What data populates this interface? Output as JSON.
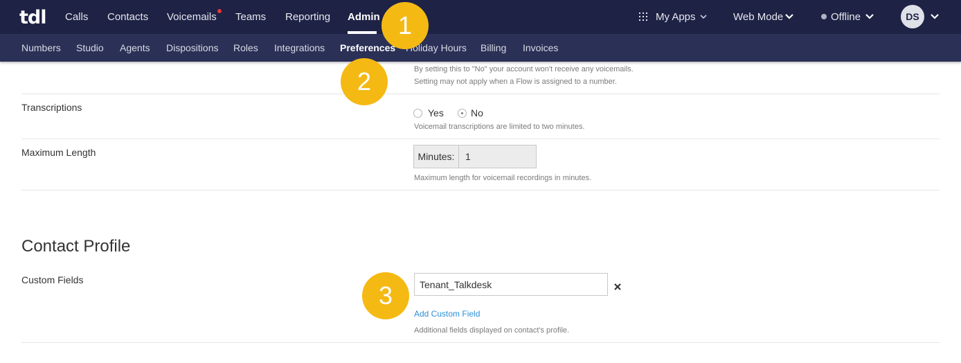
{
  "header": {
    "logo": "tdl",
    "nav": [
      {
        "label": "Calls"
      },
      {
        "label": "Contacts"
      },
      {
        "label": "Voicemails"
      },
      {
        "label": "Teams"
      },
      {
        "label": "Reporting"
      },
      {
        "label": "Admin"
      }
    ],
    "active_nav": "Admin",
    "my_apps": "My Apps",
    "web_mode": "Web Mode",
    "status": "Offline",
    "avatar_initials": "DS"
  },
  "subnav": {
    "items": [
      {
        "label": "Numbers"
      },
      {
        "label": "Studio"
      },
      {
        "label": "Agents"
      },
      {
        "label": "Dispositions"
      },
      {
        "label": "Roles"
      },
      {
        "label": "Integrations"
      },
      {
        "label": "Preferences"
      },
      {
        "label": "Holiday Hours"
      },
      {
        "label": "Billing"
      },
      {
        "label": "Invoices"
      }
    ],
    "active": "Preferences"
  },
  "badges": [
    "1",
    "2",
    "3"
  ],
  "voicemail_help": {
    "line1": "By setting this to \"No\" your account won't receive any voicemails.",
    "line2": "Setting may not apply when a Flow is assigned to a number."
  },
  "transcriptions": {
    "label": "Transcriptions",
    "options": [
      "Yes",
      "No"
    ],
    "selected": "No",
    "help": "Voicemail transcriptions are limited to two minutes."
  },
  "maximum_length": {
    "label": "Maximum Length",
    "addon": "Minutes:",
    "value": "1",
    "help": "Maximum length for voicemail recordings in minutes."
  },
  "contact_profile": {
    "title": "Contact Profile",
    "custom_fields_label": "Custom Fields",
    "field_value": "Tenant_Talkdesk",
    "add_link": "Add Custom Field",
    "help": "Additional fields displayed on contact's profile."
  },
  "colors": {
    "topbar": "#1e2245",
    "subbar": "#2b3056",
    "badge": "#f5b914",
    "link": "#2b8fd6",
    "notification_dot": "#e53935"
  },
  "icons": [
    "apps-grid-icon",
    "chevron-down-icon",
    "status-dot-icon",
    "close-icon"
  ]
}
